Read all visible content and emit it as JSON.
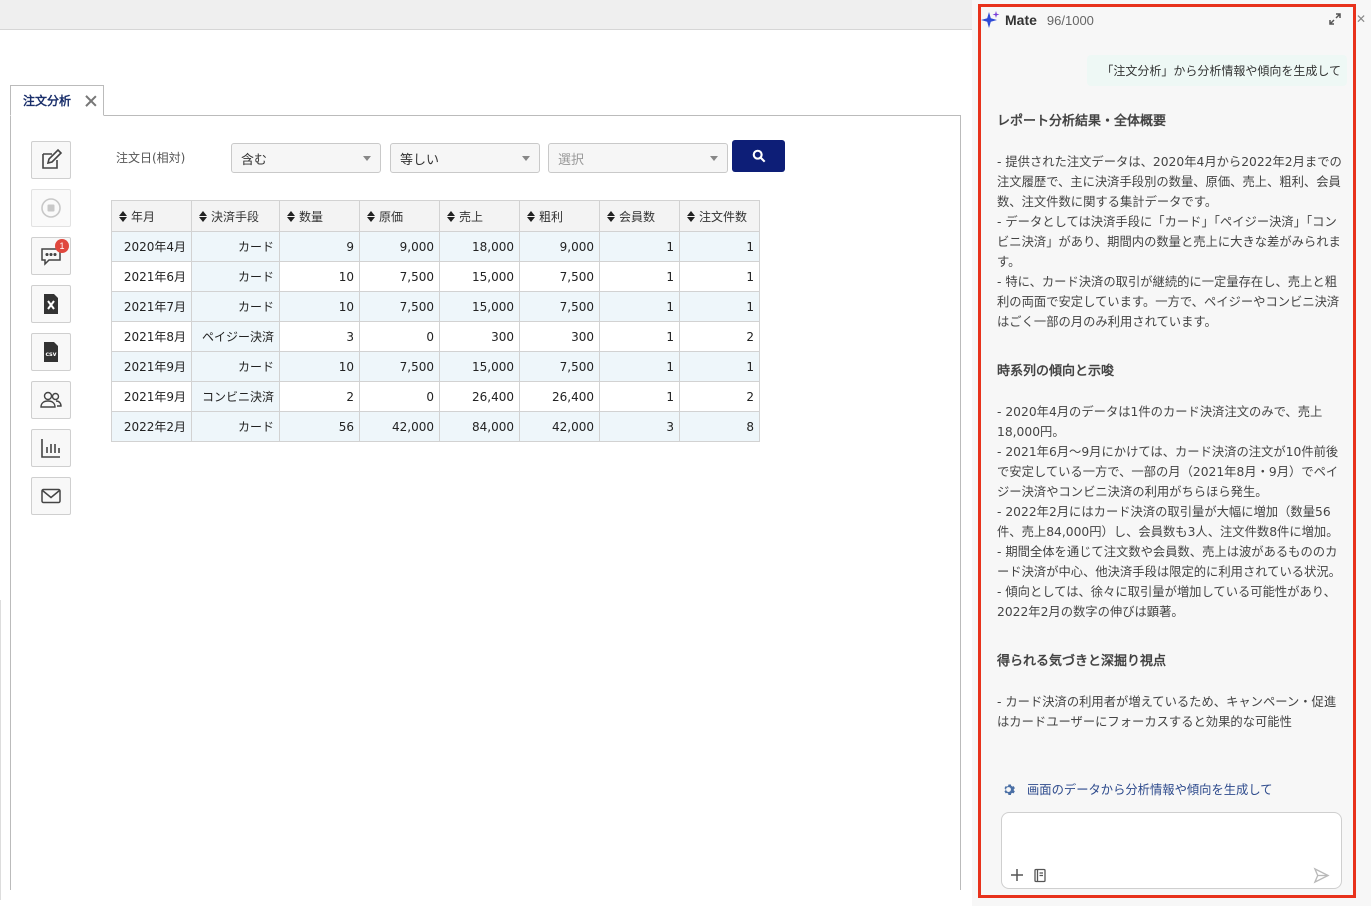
{
  "tab": {
    "label": "注文分析"
  },
  "toolbar": {
    "items": [
      {
        "icon": "edit-icon"
      },
      {
        "icon": "stop-icon"
      },
      {
        "icon": "comment-icon",
        "badge": "1"
      },
      {
        "icon": "excel-file-icon"
      },
      {
        "icon": "csv-file-icon"
      },
      {
        "icon": "users-icon"
      },
      {
        "icon": "bar-chart-icon"
      },
      {
        "icon": "mail-icon"
      }
    ]
  },
  "filter": {
    "label": "注文日(相対)",
    "select1": "含む",
    "select2": "等しい",
    "select3_placeholder": "選択"
  },
  "table": {
    "columns": [
      "年月",
      "決済手段",
      "数量",
      "原価",
      "売上",
      "粗利",
      "会員数",
      "注文件数"
    ],
    "rows": [
      [
        "2020年4月",
        "カード",
        "9",
        "9,000",
        "18,000",
        "9,000",
        "1",
        "1"
      ],
      [
        "2021年6月",
        "カード",
        "10",
        "7,500",
        "15,000",
        "7,500",
        "1",
        "1"
      ],
      [
        "2021年7月",
        "カード",
        "10",
        "7,500",
        "15,000",
        "7,500",
        "1",
        "1"
      ],
      [
        "2021年8月",
        "ペイジー決済",
        "3",
        "0",
        "300",
        "300",
        "1",
        "2"
      ],
      [
        "2021年9月",
        "カード",
        "10",
        "7,500",
        "15,000",
        "7,500",
        "1",
        "1"
      ],
      [
        "2021年9月",
        "コンビニ決済",
        "2",
        "0",
        "26,400",
        "26,400",
        "1",
        "2"
      ],
      [
        "2022年2月",
        "カード",
        "56",
        "42,000",
        "84,000",
        "42,000",
        "3",
        "8"
      ]
    ]
  },
  "mate": {
    "title": "Mate",
    "count": "96/1000",
    "user_message": "「注文分析」から分析情報や傾向を生成して",
    "sections": [
      {
        "heading": "レポート分析結果・全体概要",
        "body": "- 提供された注文データは、2020年4月から2022年2月までの注文履歴で、主に決済手段別の数量、原価、売上、粗利、会員数、注文件数に関する集計データです。\n- データとしては決済手段に「カード」「ペイジー決済」「コンビニ決済」があり、期間内の数量と売上に大きな差がみられます。\n- 特に、カード決済の取引が継続的に一定量存在し、売上と粗利の両面で安定しています。一方で、ペイジーやコンビニ決済はごく一部の月のみ利用されています。"
      },
      {
        "heading": "時系列の傾向と示唆",
        "body": "- 2020年4月のデータは1件のカード決済注文のみで、売上18,000円。\n- 2021年6月〜9月にかけては、カード決済の注文が10件前後で安定している一方で、一部の月（2021年8月・9月）でペイジー決済やコンビニ決済の利用がちらほら発生。\n- 2022年2月にはカード決済の取引量が大幅に増加（数量56件、売上84,000円）し、会員数も3人、注文件数8件に増加。\n- 期間全体を通じて注文数や会員数、売上は波があるもののカード決済が中心、他決済手段は限定的に利用されている状況。\n- 傾向としては、徐々に取引量が増加している可能性があり、2022年2月の数字の伸びは顕著。"
      },
      {
        "heading": "得られる気づきと深掘り視点",
        "body": "- カード決済の利用者が増えているため、キャンペーン・促進はカードユーザーにフォーカスすると効果的な可能性"
      }
    ],
    "suggestion": "画面のデータから分析情報や傾向を生成して",
    "input_value": ""
  }
}
